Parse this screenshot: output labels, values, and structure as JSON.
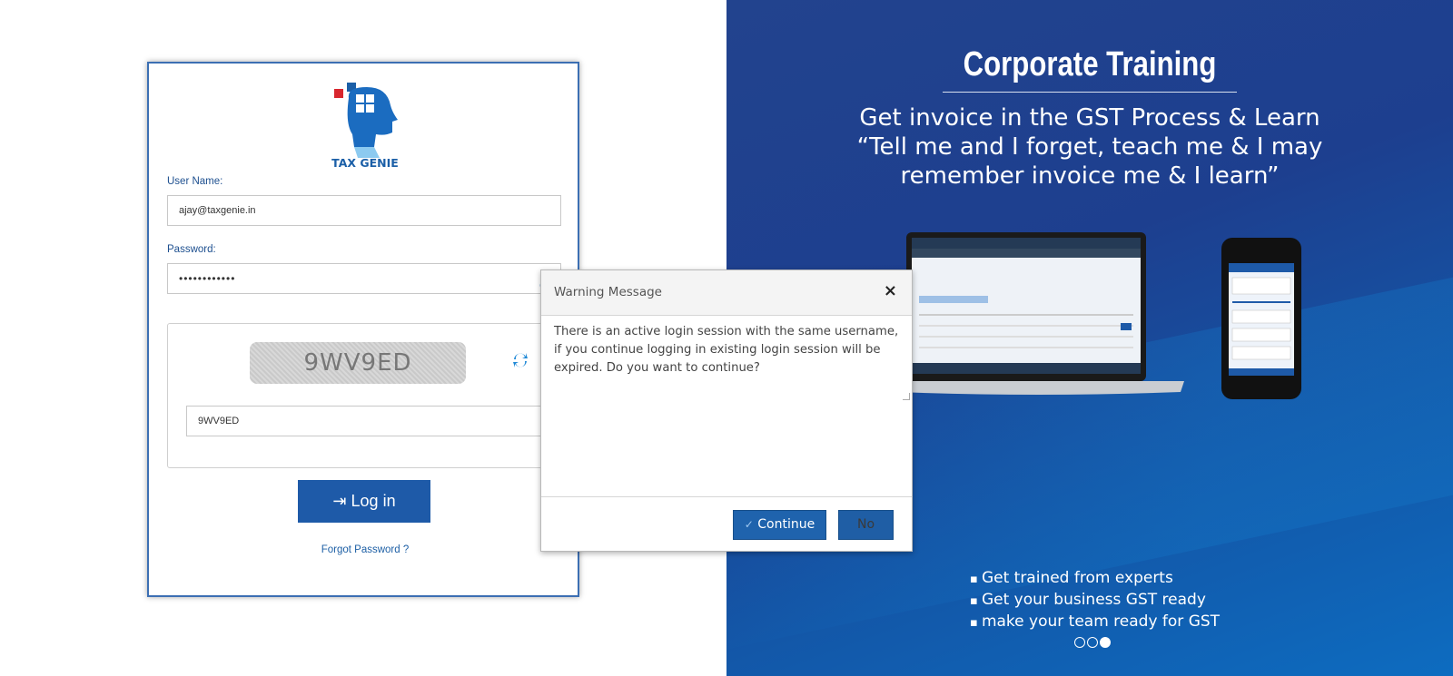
{
  "login": {
    "logo_text": "TAX GENIE",
    "username_label": "User Name:",
    "username_value": "ajay@taxgenie.in",
    "password_label": "Password:",
    "password_value": "••••••••••••",
    "captcha_text": "9WV9ED",
    "captcha_input_value": "9WV9ED",
    "login_button": "Log in",
    "forgot_link": "Forgot Password ?"
  },
  "dialog": {
    "title": "Warning Message",
    "close": "×",
    "message": "There is an active login session with the same username, if you continue logging in existing login session will be expired. Do you want to continue?",
    "continue_label": "Continue",
    "no_label": "No"
  },
  "promo": {
    "title": "Corporate Training",
    "quote_line1": "Get invoice in the GST Process &  Learn",
    "quote_line2": "“Tell me and I forget, teach me & I may",
    "quote_line3": "remember invoice me & I learn”",
    "bullets": [
      "Get trained from experts",
      "Get your business GST ready",
      "make your team ready for GST"
    ],
    "carousel_active_index": 2,
    "carousel_count": 3
  },
  "colors": {
    "brand_blue": "#1e5aa8",
    "panel_bg": "#1d3f8f"
  },
  "icons": {
    "login": "sign-in-icon",
    "refresh": "refresh-icon",
    "eye": "eye-icon",
    "close": "close-icon",
    "check": "check-icon"
  }
}
